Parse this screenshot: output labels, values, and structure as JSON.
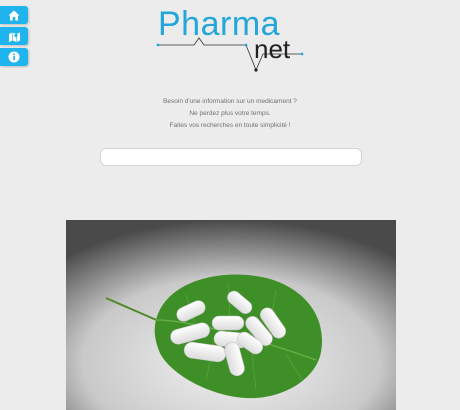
{
  "nav": {
    "items": [
      {
        "icon": "home-icon"
      },
      {
        "icon": "map-icon"
      },
      {
        "icon": "info-icon"
      }
    ]
  },
  "logo": {
    "part1": "Pharma",
    "part2": "net"
  },
  "tagline": {
    "line1": "Besoin d'une information sur un medicament ?",
    "line2": "Ne perdez plus votre temps.",
    "line3": "Faites vos recherches en toute simplicité !"
  },
  "search": {
    "placeholder": "",
    "value": ""
  },
  "colors": {
    "accent": "#1fb4ee",
    "logo_blue": "#23a6d9",
    "background": "#ececec"
  }
}
